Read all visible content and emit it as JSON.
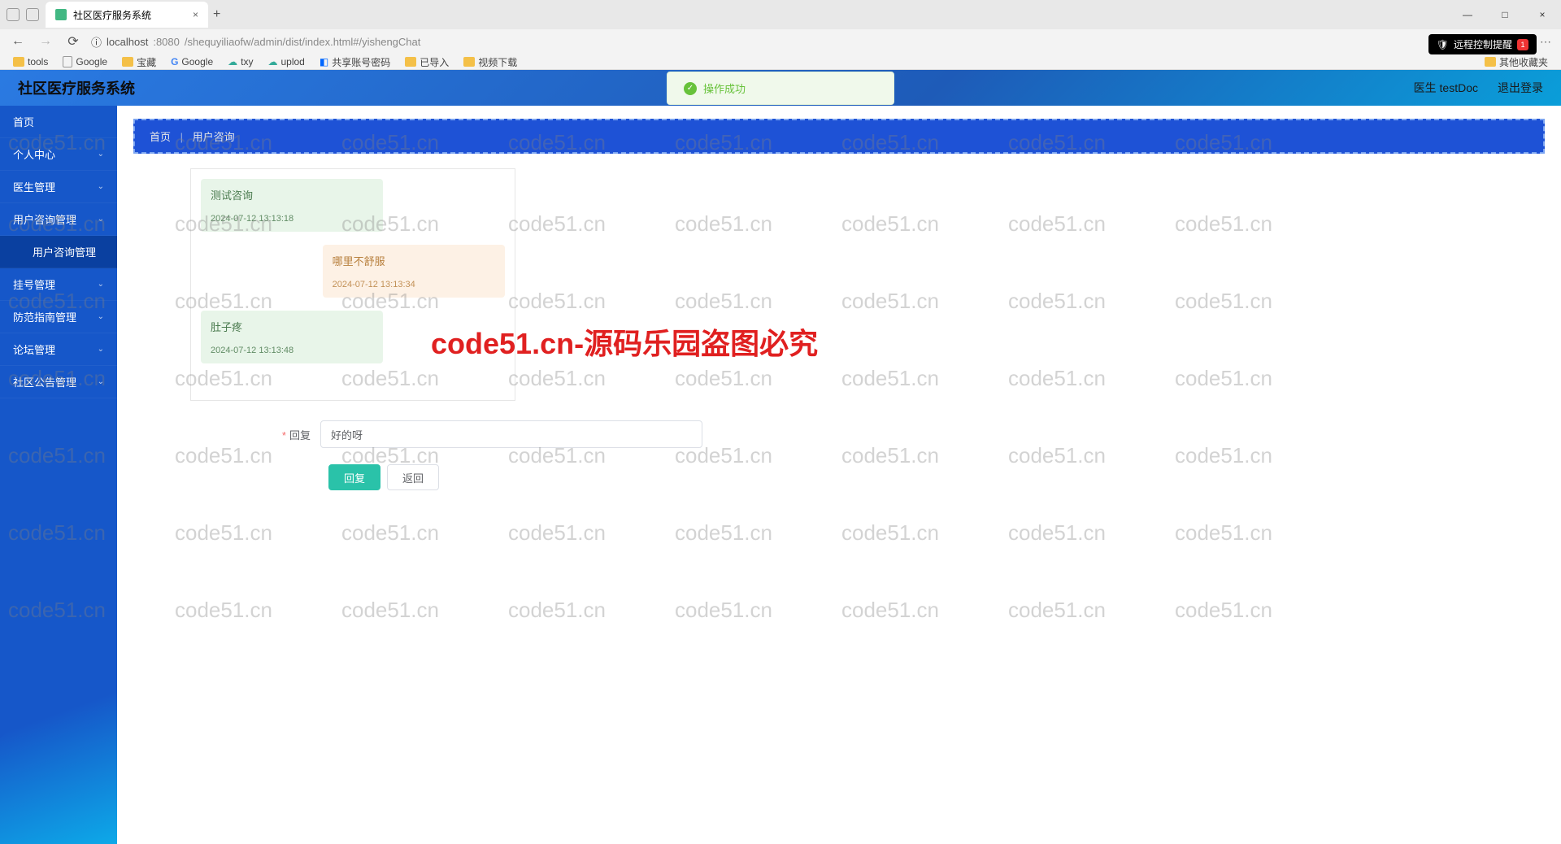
{
  "browser": {
    "tab_title": "社区医疗服务系统",
    "url_host": "localhost",
    "url_port": ":8080",
    "url_path": "/shequyiliaofw/admin/dist/index.html#/yishengChat",
    "new_tab": "+",
    "close": "×",
    "min": "—",
    "max": "□"
  },
  "bookmarks": [
    {
      "label": "tools",
      "type": "folder"
    },
    {
      "label": "Google",
      "type": "page"
    },
    {
      "label": "宝藏",
      "type": "folder"
    },
    {
      "label": "Google",
      "type": "g"
    },
    {
      "label": "txy",
      "type": "cloud"
    },
    {
      "label": "uplod",
      "type": "cloud"
    },
    {
      "label": "共享账号密码",
      "type": "app"
    },
    {
      "label": "已导入",
      "type": "folder"
    },
    {
      "label": "视频下载",
      "type": "folder"
    }
  ],
  "bookmarks_right": "其他收藏夹",
  "remote": {
    "label": "远程控制提醒",
    "count": "1"
  },
  "app": {
    "title": "社区医疗服务系统",
    "user_label": "医生 testDoc",
    "logout": "退出登录"
  },
  "toast": {
    "text": "操作成功"
  },
  "sidebar": [
    {
      "label": "首页",
      "arrow": false
    },
    {
      "label": "个人中心",
      "arrow": true
    },
    {
      "label": "医生管理",
      "arrow": true
    },
    {
      "label": "用户咨询管理",
      "arrow": true
    },
    {
      "label": "用户咨询管理",
      "arrow": false,
      "sub": true
    },
    {
      "label": "挂号管理",
      "arrow": true
    },
    {
      "label": "防范指南管理",
      "arrow": true
    },
    {
      "label": "论坛管理",
      "arrow": true
    },
    {
      "label": "社区公告管理",
      "arrow": true
    }
  ],
  "breadcrumb": {
    "home": "首页",
    "current": "用户咨询"
  },
  "chat": [
    {
      "side": "left",
      "text": "测试咨询",
      "time": "2024-07-12 13:13:18"
    },
    {
      "side": "right",
      "text": "哪里不舒服",
      "time": "2024-07-12 13:13:34"
    },
    {
      "side": "left",
      "text": "肚子疼",
      "time": "2024-07-12 13:13:48"
    }
  ],
  "form": {
    "reply_label": "回复",
    "reply_value": "好的呀",
    "submit": "回复",
    "back": "返回"
  },
  "watermark": {
    "small": "code51.cn",
    "big": "code51.cn-源码乐园盗图必究"
  }
}
